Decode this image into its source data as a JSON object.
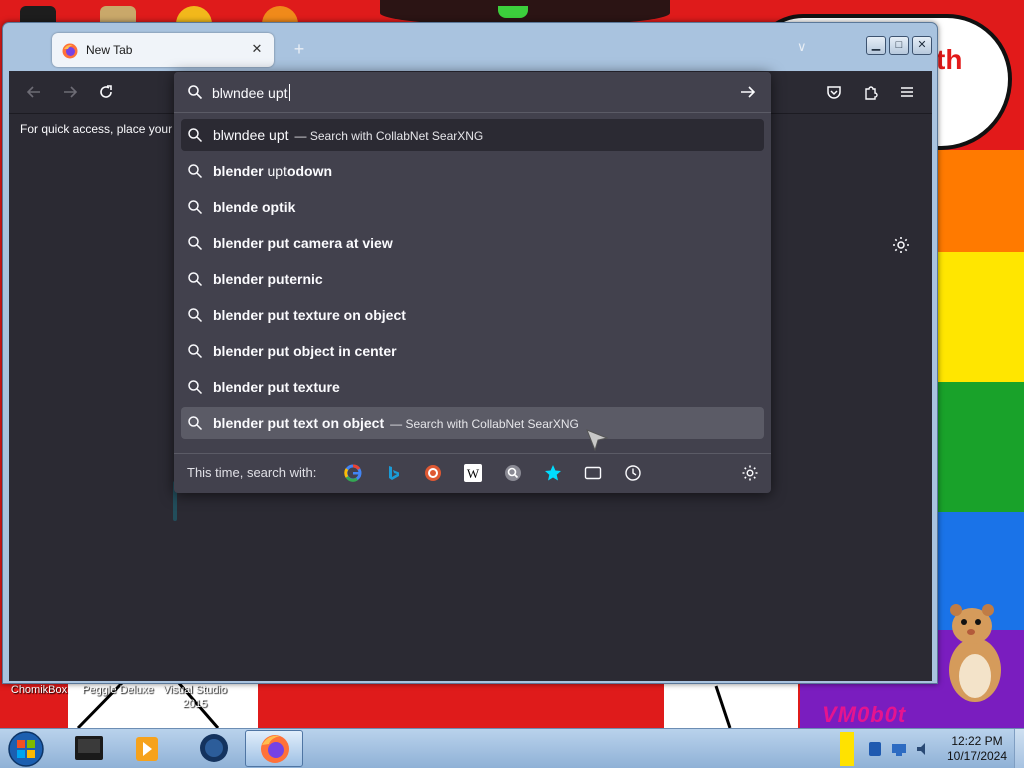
{
  "desktop": {
    "icons": [
      {
        "label": "ChomikBox"
      },
      {
        "label": "Peggle Deluxe"
      },
      {
        "label": "Visual Studio 2015"
      }
    ],
    "wallpaper_text": "VM0b0t",
    "cloud_text": "th"
  },
  "browser": {
    "tab": {
      "title": "New Tab",
      "close_label": "✕"
    },
    "new_tab_label": "+",
    "list_all_tabs_label": "∨",
    "caption": {
      "minimize": "▁",
      "maximize": "□",
      "close": "✕"
    },
    "bookmarks_bar_text": "For quick access, place your b",
    "urlbar": {
      "value": "blwndee upt",
      "results": [
        {
          "bold": "",
          "normal": "blwndee upt",
          "action": "— Search with CollabNet SearXNG",
          "state": "selected"
        },
        {
          "bold": "blender ",
          "normal": "upt",
          "bold2": "odown",
          "action": "",
          "state": ""
        },
        {
          "bold": "blende optik",
          "normal": "",
          "action": "",
          "state": ""
        },
        {
          "bold": "blender put camera at view",
          "normal": "",
          "action": "",
          "state": ""
        },
        {
          "bold": "blender puternic",
          "normal": "",
          "action": "",
          "state": ""
        },
        {
          "bold": "blender put texture on object",
          "normal": "",
          "action": "",
          "state": ""
        },
        {
          "bold": "blender put object in center",
          "normal": "",
          "action": "",
          "state": ""
        },
        {
          "bold": "blender put texture",
          "normal": "",
          "action": "",
          "state": ""
        },
        {
          "bold": "blender put text on object",
          "normal": "",
          "action": "— Search with CollabNet SearXNG",
          "state": "hover"
        }
      ],
      "one_off_label": "This time, search with:",
      "engines": [
        "google-icon",
        "bing-icon",
        "duckduckgo-icon",
        "wikipedia-icon",
        "searxng-icon",
        "bookmarks-icon",
        "tabs-icon",
        "history-icon"
      ]
    }
  },
  "taskbar": {
    "apps": [
      "chomikbox-app",
      "media-app",
      "globe-app",
      "firefox-app"
    ],
    "active_app": "firefox-app",
    "clock": {
      "time": "12:22 PM",
      "date": "10/17/2024"
    }
  },
  "colors": {
    "wallpaper_red": "#df1b1b",
    "firefox_toolbar": "#2b2a33",
    "urlbar_popup": "#42414d",
    "taskbar": "#a9c6e6"
  }
}
